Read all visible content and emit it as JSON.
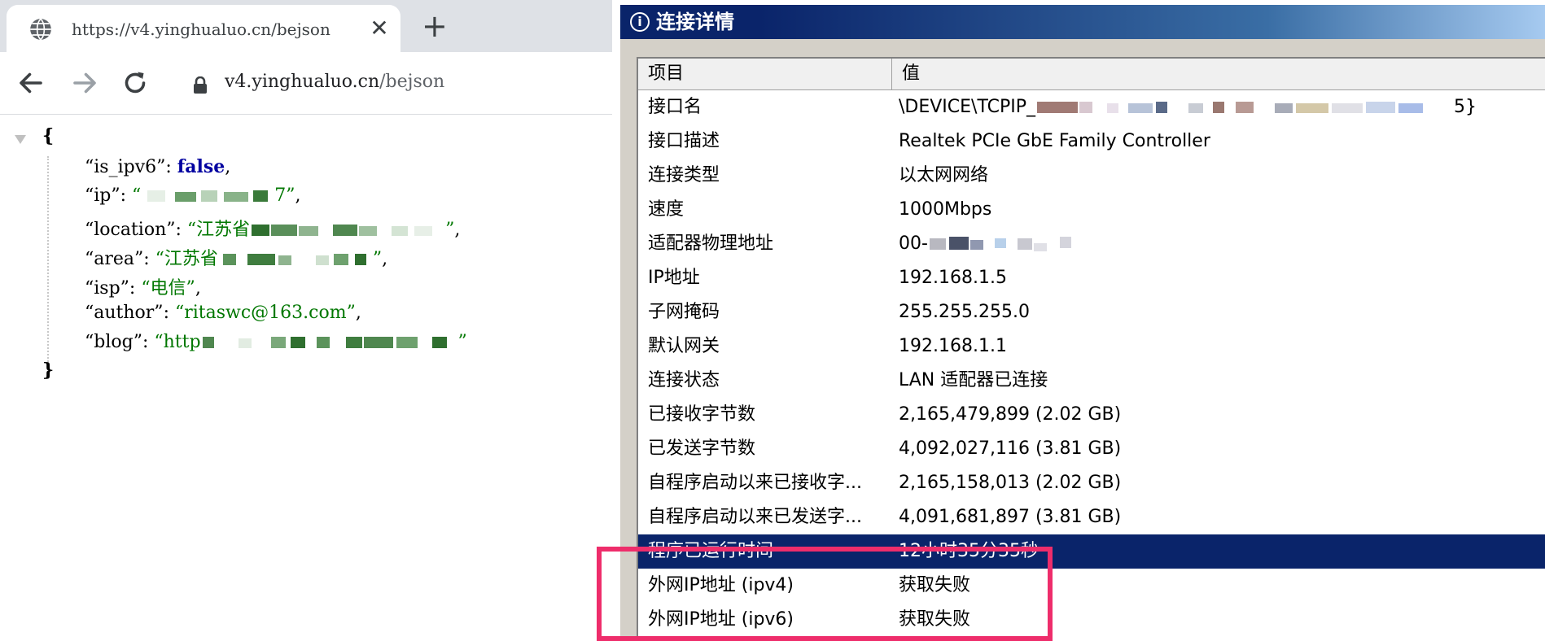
{
  "browser": {
    "tab": {
      "title": "https://v4.yinghualuo.cn/bejson",
      "close_glyph": "✕",
      "icon": "globe-icon"
    },
    "new_tab_glyph": "+",
    "toolbar": {
      "back_icon": "arrow-left-icon",
      "forward_icon": "arrow-right-icon",
      "reload_icon": "reload-icon",
      "lock_icon": "lock-icon",
      "url_host": "v4.yinghualuo.cn",
      "url_path": "/bejson"
    },
    "json": {
      "open_brace": "{",
      "close_brace": "}",
      "lines": [
        {
          "key": "“is_ipv6”",
          "sep": ": ",
          "value": "false",
          "tail": ","
        },
        {
          "key": "“ip”",
          "sep": ": ",
          "value_start": "“",
          "value_end": "7”",
          "tail": ","
        },
        {
          "key": "“location”",
          "sep": ": ",
          "value_start": "“江苏省",
          "value_end": "”",
          "tail": ","
        },
        {
          "key": "“area”",
          "sep": ": ",
          "value_start": "“江苏省",
          "value_end": "”",
          "tail": ","
        },
        {
          "key": "“isp”",
          "sep": ": ",
          "value": "“电信”",
          "tail": ","
        },
        {
          "key": "“author”",
          "sep": ": ",
          "value": "“ritaswc@163.com”",
          "tail": ","
        },
        {
          "key": "“blog”",
          "sep": ": ",
          "value_start": "“http",
          "value_end": "”",
          "tail": ""
        }
      ]
    }
  },
  "dialog": {
    "title": "连接详情",
    "title_icon": "info-icon",
    "columns": {
      "item": "项目",
      "value": "值"
    },
    "rows": [
      {
        "item": "接口名",
        "value": "\\DEVICE\\TCPIP_",
        "value_tail": "5}"
      },
      {
        "item": "接口描述",
        "value": "Realtek PCIe GbE Family Controller"
      },
      {
        "item": "连接类型",
        "value": "以太网网络"
      },
      {
        "item": "速度",
        "value": "1000Mbps"
      },
      {
        "item": "适配器物理地址",
        "value": "00-"
      },
      {
        "item": "IP地址",
        "value": "192.168.1.5"
      },
      {
        "item": "子网掩码",
        "value": "255.255.255.0"
      },
      {
        "item": "默认网关",
        "value": "192.168.1.1"
      },
      {
        "item": "连接状态",
        "value": "LAN 适配器已连接"
      },
      {
        "item": "已接收字节数",
        "value": "2,165,479,899 (2.02 GB)"
      },
      {
        "item": "已发送字节数",
        "value": "4,092,027,116 (3.81 GB)"
      },
      {
        "item": "自程序启动以来已接收字...",
        "value": "2,165,158,013 (2.02 GB)"
      },
      {
        "item": "自程序启动以来已发送字...",
        "value": "4,091,681,897 (3.81 GB)"
      },
      {
        "item": "程序已运行时间",
        "value": "12小时35分35秒",
        "selected": true
      },
      {
        "item": "外网IP地址 (ipv4)",
        "value": "获取失败"
      },
      {
        "item": "外网IP地址 (ipv6)",
        "value": "获取失败"
      }
    ],
    "highlight_color": "#ee2d6b",
    "selection_color": "#0a246a"
  }
}
